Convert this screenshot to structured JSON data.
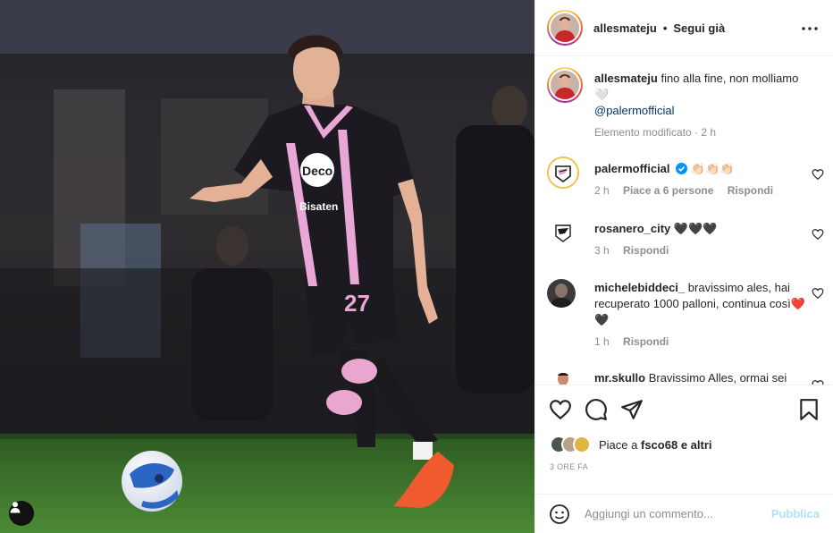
{
  "post": {
    "author": "allesmateju",
    "separator": "•",
    "follow_status": "Segui già",
    "more_icon": "more-horizontal-icon"
  },
  "caption": {
    "user": "allesmateju",
    "text": "fino alla fine, non molliamo🤍",
    "mention": "@palermofficial",
    "meta": "Elemento modificato · 2 h"
  },
  "comments": [
    {
      "user": "palermofficial",
      "verified": true,
      "text": "👏🏻👏🏻👏🏻",
      "time": "2 h",
      "likes": "Piace a 6 persone",
      "reply": "Rispondi"
    },
    {
      "user": "rosanero_city",
      "verified": false,
      "text": "🖤🖤🖤",
      "time": "3 h",
      "likes": "",
      "reply": "Rispondi"
    },
    {
      "user": "michelebiddeci_",
      "verified": false,
      "text": "bravissimo ales, hai recuperato 1000 palloni, continua così❤️🖤",
      "time": "1 h",
      "likes": "",
      "reply": "Rispondi"
    },
    {
      "user": "mr.skullo",
      "verified": false,
      "text": "Bravissimo Alles, ormai sei",
      "time": "",
      "likes": "",
      "reply": ""
    }
  ],
  "actions": {
    "like_icon": "heart-icon",
    "comment_icon": "comment-icon",
    "share_icon": "send-icon",
    "save_icon": "bookmark-icon"
  },
  "likes": {
    "prefix": "Piace a",
    "user": "fsco68",
    "suffix": "e altri"
  },
  "time_ago": "3 ORE FA",
  "composer": {
    "placeholder": "Aggiungi un commento...",
    "publish": "Pubblica"
  },
  "colors": {
    "jersey": "#1c1a20",
    "jersey_trim": "#e8a7d4",
    "link": "#00376b",
    "publish_disabled": "#b2dffc",
    "meta_gray": "#8e8e8e",
    "pitch": "#3f7a2b"
  }
}
